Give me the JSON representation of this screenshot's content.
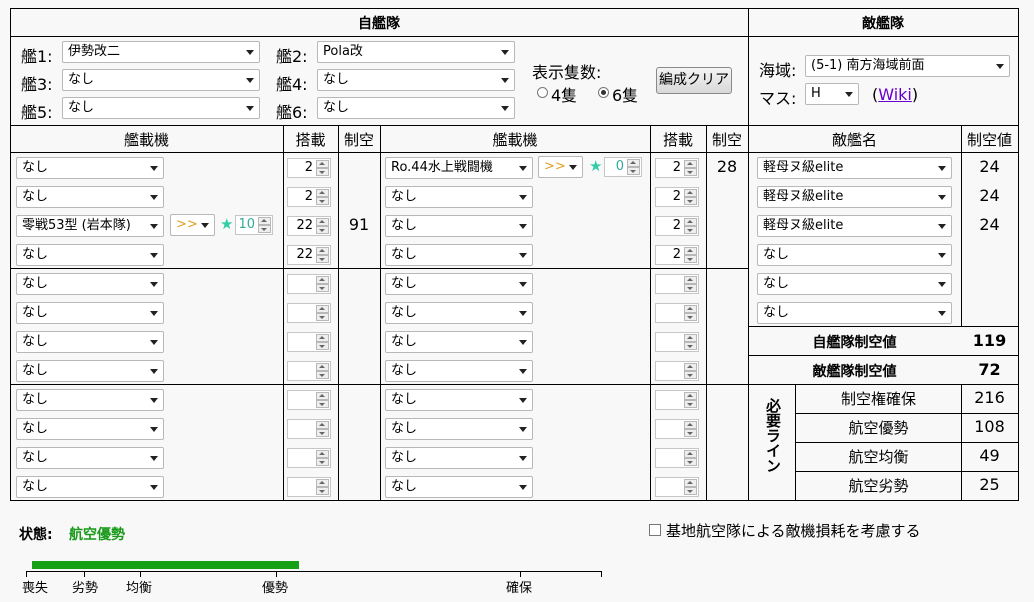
{
  "own_fleet_title": "自艦隊",
  "enemy_fleet_title": "敵艦隊",
  "ship_labels": [
    "艦1:",
    "艦2:",
    "艦3:",
    "艦4:",
    "艦5:",
    "艦6:"
  ],
  "ships": [
    "伊勢改二",
    "Pola改",
    "なし",
    "なし",
    "なし",
    "なし"
  ],
  "display_count_label": "表示隻数:",
  "count_4": "4隻",
  "count_6": "6隻",
  "clear_button": "編成クリア",
  "area_label": "海域:",
  "area_value": "(5-1) 南方海域前面",
  "node_label": "マス:",
  "node_value": "H",
  "wiki_open": "(",
  "wiki_link": "Wiki",
  "wiki_close": ")",
  "col_equip": "艦載機",
  "col_slots": "搭載",
  "col_air": "制空",
  "col_enemy_name": "敵艦名",
  "col_enemy_air": "制空値",
  "left_equips": [
    "なし",
    "なし",
    "零戦53型 (岩本隊)",
    "なし",
    "なし",
    "なし",
    "なし",
    "なし",
    "なし",
    "なし",
    "なし",
    "なし"
  ],
  "left_slots": [
    "2",
    "2",
    "22",
    "22",
    "",
    "",
    "",
    "",
    "",
    "",
    "",
    ""
  ],
  "left_air": "91",
  "left_prof": ">>",
  "left_star": "10",
  "right_equips": [
    "Ro.44水上戦闘機",
    "なし",
    "なし",
    "なし",
    "なし",
    "なし",
    "なし",
    "なし",
    "なし",
    "なし",
    "なし",
    "なし"
  ],
  "right_slots": [
    "2",
    "2",
    "2",
    "2",
    "",
    "",
    "",
    "",
    "",
    "",
    "",
    ""
  ],
  "right_air": "28",
  "right_prof": ">>",
  "right_star": "0",
  "enemies": [
    "軽母ヌ級elite",
    "軽母ヌ級elite",
    "軽母ヌ級elite",
    "なし",
    "なし",
    "なし"
  ],
  "enemy_air": [
    "24",
    "24",
    "24",
    "",
    "",
    ""
  ],
  "own_air_label": "自艦隊制空値",
  "own_air_value": "119",
  "enemy_air_label": "敵艦隊制空値",
  "enemy_air_value": "72",
  "required_line_label": "必要ライン",
  "thresholds": [
    {
      "label": "制空権確保",
      "value": "216"
    },
    {
      "label": "航空優勢",
      "value": "108"
    },
    {
      "label": "航空均衡",
      "value": "49"
    },
    {
      "label": "航空劣勢",
      "value": "25"
    }
  ],
  "state_label": "状態:",
  "state_value": "航空優勢",
  "base_air_checkbox": "基地航空隊による敵機損耗を考慮する",
  "bar_labels": [
    "喪失",
    "劣勢",
    "均衡",
    "優勢",
    "確保"
  ],
  "bar_fill_fraction": 0.47,
  "colors": {
    "state": "#1a9a1a",
    "bar": "#16a016",
    "star": "#33ccaa",
    "prof": "#e0a020",
    "link": "#6600cc"
  }
}
